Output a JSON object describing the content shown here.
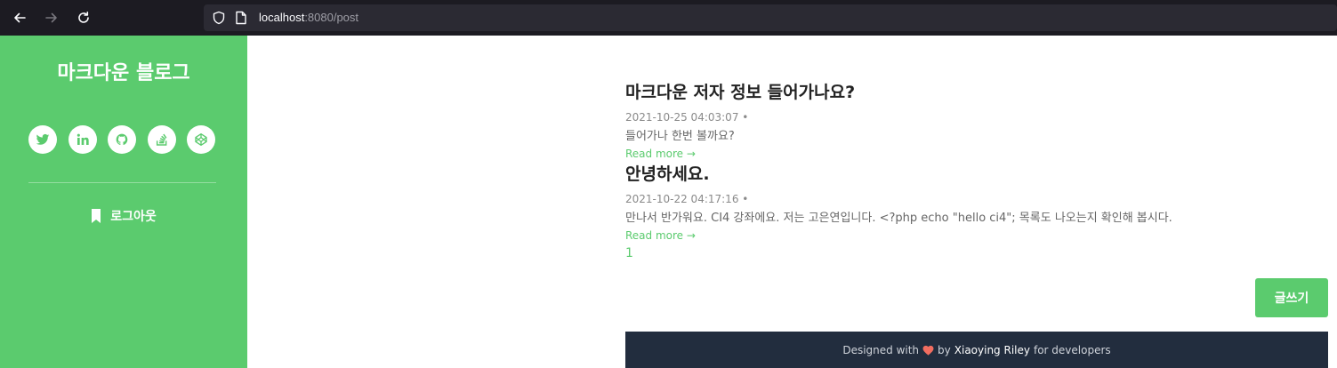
{
  "browser": {
    "url_host": "localhost",
    "url_path": ":8080/post"
  },
  "sidebar": {
    "blog_title": "마크다운 블로그",
    "social_icons": [
      "twitter-icon",
      "linkedin-icon",
      "github-icon",
      "stackoverflow-icon",
      "codepen-icon"
    ],
    "logout_label": "로그아웃"
  },
  "posts": [
    {
      "title": "마크다운 저자 정보 들어가나요?",
      "meta": "2021-10-25 04:03:07  •",
      "excerpt": "들어가나 한번 볼까요?",
      "read_more": "Read more →"
    },
    {
      "title": "안녕하세요.",
      "meta": "2021-10-22 04:17:16  •",
      "excerpt": "만나서 반가워요. CI4 강좌에요. 저는 고은연입니다. <?php echo \"hello ci4\"; 목록도 나오는지 확인해 봅시다.",
      "read_more": "Read more →"
    }
  ],
  "pagination": {
    "current": "1"
  },
  "write_button": "글쓰기",
  "footer": {
    "prefix": "Designed with",
    "by": "by",
    "author": "Xiaoying Riley",
    "suffix": "for developers"
  },
  "colors": {
    "accent": "#5bcb6e",
    "footer_bg": "#222d3e",
    "heart": "#f26d60"
  }
}
